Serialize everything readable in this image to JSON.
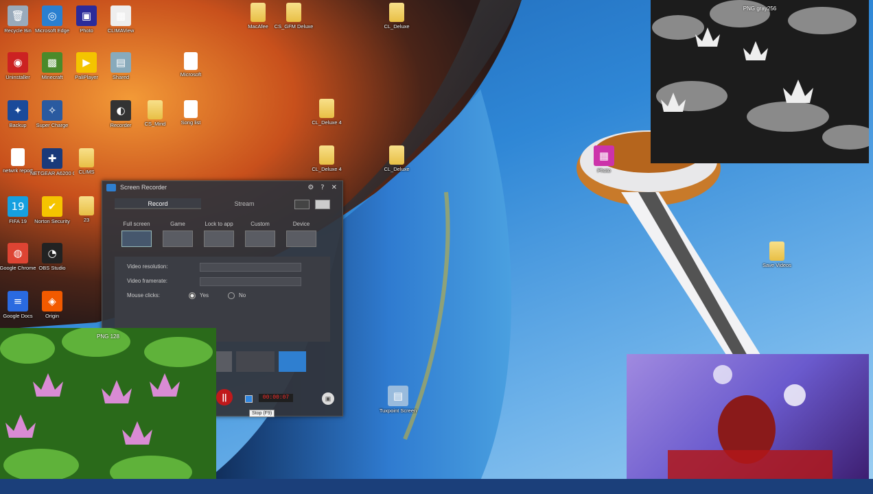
{
  "desktop_icons": [
    {
      "label": "Recycle Bin",
      "glyph": "🗑",
      "kind": "app",
      "color": "#9ab"
    },
    {
      "label": "Microsoft Edge",
      "glyph": "◎",
      "kind": "app",
      "color": "#2a7fd0"
    },
    {
      "label": "Photo",
      "glyph": "▣",
      "kind": "app",
      "color": "#2b2b9a"
    },
    {
      "label": "CLIMAView",
      "glyph": "▦",
      "kind": "app",
      "color": "#eee"
    },
    {
      "label": "Uninstaller",
      "glyph": "◉",
      "kind": "app",
      "color": "#c22"
    },
    {
      "label": "Minecraft",
      "glyph": "▩",
      "kind": "app",
      "color": "#4a8a2a"
    },
    {
      "label": "PaliPlayer",
      "glyph": "▶",
      "kind": "app",
      "color": "#f4c400"
    },
    {
      "label": "Shared",
      "glyph": "▤",
      "kind": "app",
      "color": "#8ab"
    },
    {
      "label": "Microsoft",
      "glyph": "",
      "kind": "doc",
      "color": "#fff"
    },
    {
      "label": "Backup",
      "glyph": "✦",
      "kind": "app",
      "color": "#1a4a9a"
    },
    {
      "label": "Super Charge",
      "glyph": "✧",
      "kind": "app",
      "color": "#2a5aa0"
    },
    {
      "label": "Recorder",
      "glyph": "◐",
      "kind": "app",
      "color": "#333"
    },
    {
      "label": "CS_Mind",
      "glyph": "",
      "kind": "folder",
      "color": "#e8bf45"
    },
    {
      "label": "Song list",
      "glyph": "",
      "kind": "doc",
      "color": "#fff"
    },
    {
      "label": "netwrk report",
      "glyph": "",
      "kind": "doc",
      "color": "#fff"
    },
    {
      "label": "NETGEAR A6200 Genie",
      "glyph": "✚",
      "kind": "app",
      "color": "#1a3a7a"
    },
    {
      "label": "CLIMS",
      "glyph": "",
      "kind": "folder",
      "color": "#e8bf45"
    },
    {
      "label": "FIFA 19",
      "glyph": "19",
      "kind": "app",
      "color": "#16a0e0"
    },
    {
      "label": "Norton Security",
      "glyph": "✔",
      "kind": "app",
      "color": "#f5c400"
    },
    {
      "label": "23",
      "glyph": "",
      "kind": "folder",
      "color": "#e8bf45"
    },
    {
      "label": "Google Chrome",
      "glyph": "◍",
      "kind": "app",
      "color": "#dd4433"
    },
    {
      "label": "OBS Studio",
      "glyph": "◔",
      "kind": "app",
      "color": "#222"
    },
    {
      "label": "Google Docs",
      "glyph": "≡",
      "kind": "app",
      "color": "#2a6ae0"
    },
    {
      "label": "Origin",
      "glyph": "◈",
      "kind": "app",
      "color": "#f25a00"
    },
    {
      "label": "MacAfee",
      "glyph": "",
      "kind": "folder",
      "color": "#e8bf45"
    },
    {
      "label": "CS_GFM Deluxe",
      "glyph": "",
      "kind": "folder",
      "color": "#e8bf45"
    },
    {
      "label": "CL_Deluxe",
      "glyph": "",
      "kind": "folder",
      "color": "#e8bf45"
    },
    {
      "label": "CL_Deluxe 4",
      "glyph": "",
      "kind": "folder",
      "color": "#e8bf45"
    },
    {
      "label": "CL_Deluxe 4",
      "glyph": "",
      "kind": "folder",
      "color": "#e8bf45"
    },
    {
      "label": "CL_Deluxe",
      "glyph": "",
      "kind": "folder",
      "color": "#e8bf45"
    },
    {
      "label": "Photo",
      "glyph": "▦",
      "kind": "app",
      "color": "#c3a"
    },
    {
      "label": "Save Videos",
      "glyph": "",
      "kind": "folder",
      "color": "#e8bf45"
    },
    {
      "label": "Tuxpoint Screen",
      "glyph": "▤",
      "kind": "app",
      "color": "#9bd"
    }
  ],
  "recorder": {
    "title": "Screen Recorder",
    "help_icon": "?",
    "settings_icon": "⚙",
    "close_icon": "✕",
    "tabs": [
      {
        "label": "Record",
        "active": true
      },
      {
        "label": "Stream",
        "active": false
      }
    ],
    "modes": [
      {
        "label": "Full screen",
        "active": true
      },
      {
        "label": "Game",
        "active": false
      },
      {
        "label": "Lock to app",
        "active": false
      },
      {
        "label": "Custom",
        "active": false
      },
      {
        "label": "Device",
        "active": false
      }
    ],
    "settings": {
      "video_resolution_label": "Video resolution:",
      "video_framerate_label": "Video framerate:",
      "mouse_clicks_label": "Mouse clicks:",
      "yes_label": "Yes",
      "no_label": "No",
      "mouse_clicks_value": "Yes"
    },
    "timer": "00:00:07",
    "stop_tooltip": "Stop (F9)",
    "pause_glyph": "||"
  },
  "panels": {
    "gray_title": "PNG gray256",
    "color_title": "PNG 128"
  },
  "colors": {
    "recorder_accent": "#2f7fd0",
    "record_red": "#c0191b",
    "timer_red": "#ff2a2a"
  }
}
